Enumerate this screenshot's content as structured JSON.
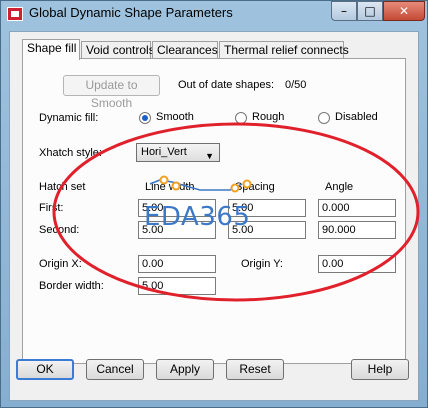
{
  "window": {
    "title": "Global Dynamic Shape Parameters",
    "minimize_glyph": "–",
    "maximize_glyph": "□",
    "close_glyph": "✕"
  },
  "tabs": [
    {
      "label": "Shape fill",
      "active": true
    },
    {
      "label": "Void controls",
      "active": false
    },
    {
      "label": "Clearances",
      "active": false
    },
    {
      "label": "Thermal relief connects",
      "active": false
    }
  ],
  "update": {
    "button_label": "Update to Smooth",
    "out_of_date_label": "Out of date shapes:",
    "out_of_date_value": "0/50"
  },
  "dynamic_fill": {
    "label": "Dynamic fill:",
    "options": [
      {
        "label": "Smooth",
        "selected": true
      },
      {
        "label": "Rough",
        "selected": false
      },
      {
        "label": "Disabled",
        "selected": false
      }
    ]
  },
  "xhatch": {
    "label": "Xhatch style:",
    "value": "Hori_Vert",
    "arrow_glyph": "▼"
  },
  "hatch": {
    "section_label": "Hatch set",
    "col_line_width": "Line width",
    "col_spacing": "Spacing",
    "col_angle": "Angle",
    "first_label": "First:",
    "first": {
      "line_width": "5.00",
      "spacing": "5.00",
      "angle": "0.000"
    },
    "second_label": "Second:",
    "second": {
      "line_width": "5.00",
      "spacing": "5.00",
      "angle": "90.000"
    }
  },
  "origin": {
    "x_label": "Origin X:",
    "x_value": "0.00",
    "y_label": "Origin Y:",
    "y_value": "0.00"
  },
  "border": {
    "label": "Border width:",
    "value": "5.00"
  },
  "footer": {
    "ok": "OK",
    "cancel": "Cancel",
    "apply": "Apply",
    "reset": "Reset",
    "help": "Help"
  },
  "overlay": {
    "watermark_text": "EDA365",
    "annotation_color": "#e0202a",
    "watermark_color": "#3c78c8",
    "accent_color": "#1b5fc7"
  }
}
